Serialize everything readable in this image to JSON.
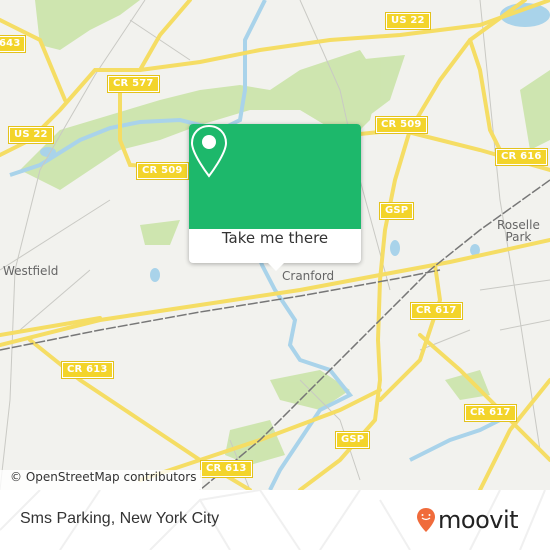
{
  "map": {
    "road_shields": [
      {
        "label": "US 22",
        "id": "us22-east"
      },
      {
        "label": "US 22",
        "id": "us22-west"
      },
      {
        "label": "CR 577",
        "id": "cr577"
      },
      {
        "label": "CR 509",
        "id": "cr509-west"
      },
      {
        "label": "CR 509",
        "id": "cr509-east"
      },
      {
        "label": "CR 616",
        "id": "cr616"
      },
      {
        "label": "GSP",
        "id": "gsp-north"
      },
      {
        "label": "CR 617",
        "id": "cr617-north"
      },
      {
        "label": "CR 613",
        "id": "cr613-west"
      },
      {
        "label": "CR 617",
        "id": "cr617-south"
      },
      {
        "label": "GSP",
        "id": "gsp-south"
      },
      {
        "label": "CR 613",
        "id": "cr613-south"
      },
      {
        "label": "643",
        "id": "r643"
      }
    ],
    "places": {
      "westfield": "Westfield",
      "cranford": "Cranford",
      "roselle_line1": "Roselle",
      "roselle_line2": "Park"
    },
    "attribution": "© OpenStreetMap contributors",
    "colors": {
      "background": "#f2f2ee",
      "park": "#c8e3a5",
      "water": "#a9d3ea",
      "major_road": "#f5dd64",
      "rail": "#777777"
    }
  },
  "popup": {
    "icon": "location-pin-icon",
    "button_label": "Take me there",
    "color": "#1db86b"
  },
  "footer": {
    "title": "Sms Parking, New York City",
    "logo_text": "moovit",
    "logo_color": "#f06b3b"
  }
}
